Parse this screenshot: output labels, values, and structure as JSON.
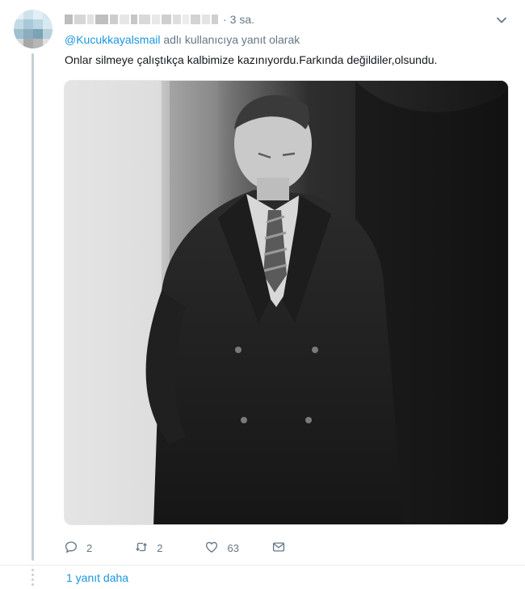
{
  "tweet": {
    "time": "3 sa.",
    "reply_handle": "@Kucukkayalsmail",
    "reply_suffix": " adlı kullanıcıya yanıt olarak",
    "text": "Onlar silmeye çalıştıkça kalbimize kazınıyordu.Farkında değildiler,olsundu.",
    "separator": "·"
  },
  "actions": {
    "reply_count": "2",
    "retweet_count": "2",
    "like_count": "63"
  },
  "thread": {
    "more_replies": "1 yanıt daha"
  },
  "colors": {
    "link": "#1b95e0",
    "muted": "#657786",
    "thread_line": "#c4cfd6"
  },
  "icons": {
    "reply": "speech-bubble",
    "retweet": "retweet-arrows",
    "like": "heart",
    "dm": "envelope",
    "caret": "chevron-down"
  }
}
